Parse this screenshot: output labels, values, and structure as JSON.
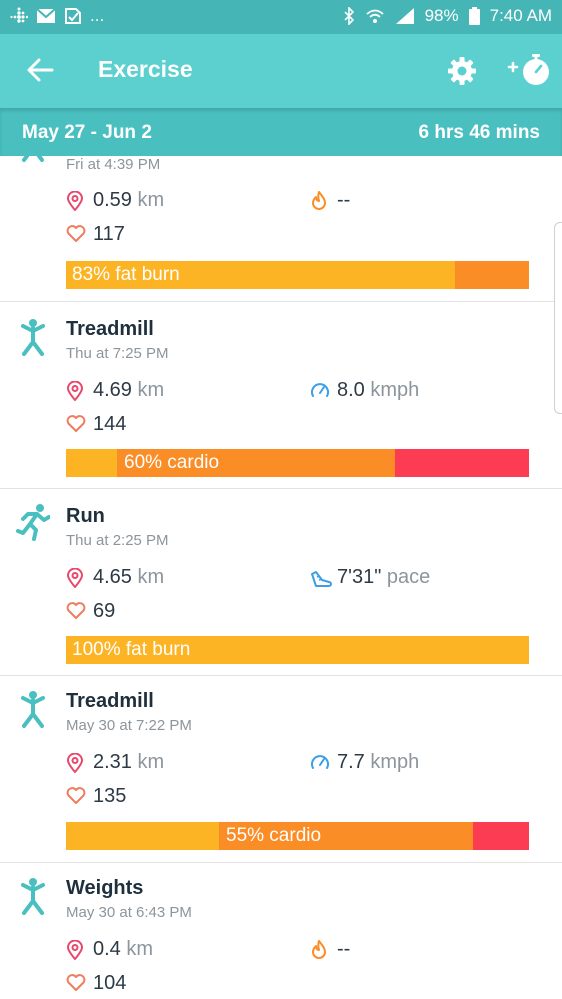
{
  "status": {
    "battery": "98%",
    "time": "7:40 AM",
    "left_icons": [
      "fitbit-icon",
      "mail-icon",
      "checklist-icon",
      "more-dots"
    ],
    "more": "..."
  },
  "appbar": {
    "title": "Exercise"
  },
  "range": {
    "dates": "May 27 - Jun 2",
    "total": "6 hrs 46 mins"
  },
  "colors": {
    "primary": "#5ccfcf",
    "fat_burn": "#fdb424",
    "cardio": "#fb8d26",
    "peak": "#fc3c53",
    "icon_teal": "#49bfc0",
    "location_pink": "#e8486b",
    "heart": "#f07c5d",
    "speed_blue": "#3d9ee8"
  },
  "activities": [
    {
      "name": "",
      "when": "Fri at 4:39 PM",
      "icon": "walk-icon",
      "distance": "0.59",
      "distance_unit": "km",
      "secondary": "--",
      "secondary_unit": "",
      "secondary_icon": "flame-icon",
      "heart_rate": "117",
      "zone_label": "83% fat burn",
      "zones": {
        "fat_burn": 0.84,
        "cardio": 0.16,
        "peak": 0.0
      }
    },
    {
      "name": "Treadmill",
      "when": "Thu at 7:25 PM",
      "icon": "treadmill-icon",
      "distance": "4.69",
      "distance_unit": "km",
      "secondary": "8.0",
      "secondary_unit": "kmph",
      "secondary_icon": "speedometer-icon",
      "heart_rate": "144",
      "zone_label": "60% cardio",
      "zones": {
        "fat_burn": 0.11,
        "cardio": 0.6,
        "peak": 0.29
      }
    },
    {
      "name": "Run",
      "when": "Thu at 2:25 PM",
      "icon": "run-icon",
      "distance": "4.65",
      "distance_unit": "km",
      "secondary": "7'31\"",
      "secondary_unit": "pace",
      "secondary_icon": "shoe-icon",
      "heart_rate": "69",
      "zone_label": "100% fat burn",
      "zones": {
        "fat_burn": 1.0,
        "cardio": 0.0,
        "peak": 0.0
      }
    },
    {
      "name": "Treadmill",
      "when": "May 30 at 7:22 PM",
      "icon": "treadmill-icon",
      "distance": "2.31",
      "distance_unit": "km",
      "secondary": "7.7",
      "secondary_unit": "kmph",
      "secondary_icon": "speedometer-icon",
      "heart_rate": "135",
      "zone_label": "55% cardio",
      "zones": {
        "fat_burn": 0.33,
        "cardio": 0.55,
        "peak": 0.12
      }
    },
    {
      "name": "Weights",
      "when": "May 30 at 6:43 PM",
      "icon": "weights-icon",
      "distance": "0.4",
      "distance_unit": "km",
      "secondary": "--",
      "secondary_unit": "",
      "secondary_icon": "flame-icon",
      "heart_rate": "104",
      "zone_label": "",
      "zones": {
        "fat_burn": 0.0,
        "cardio": 0.0,
        "peak": 0.0
      }
    }
  ]
}
